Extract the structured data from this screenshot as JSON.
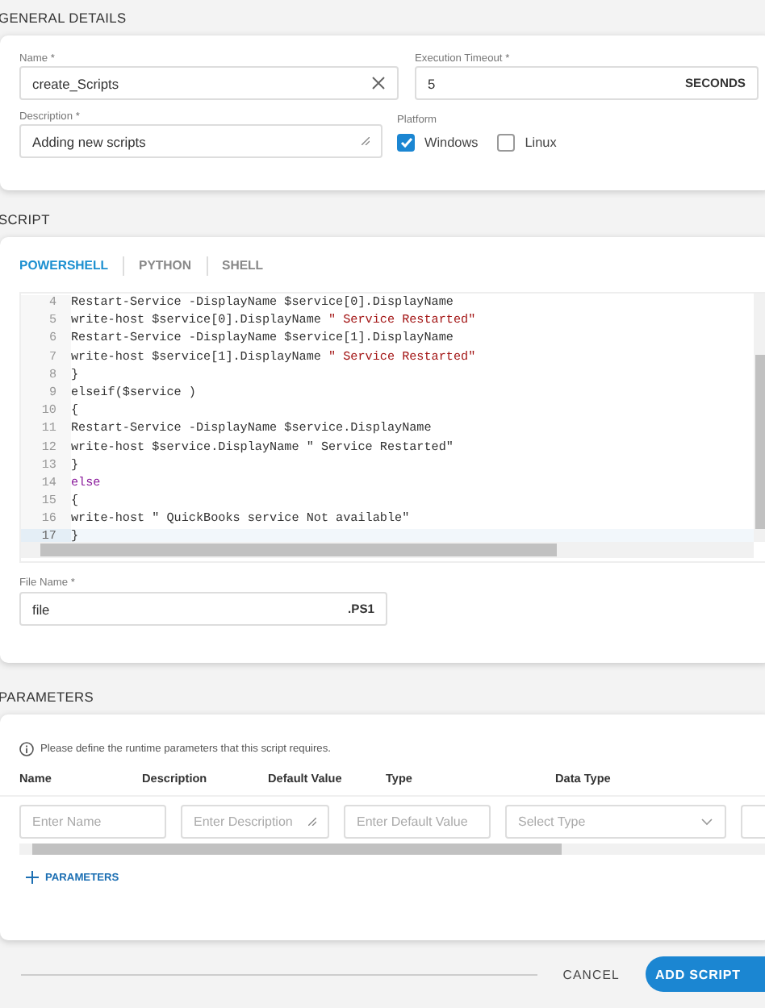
{
  "general": {
    "heading": "GENERAL DETAILS",
    "name": {
      "label": "Name *",
      "value": "create_Scripts"
    },
    "timeout": {
      "label": "Execution Timeout *",
      "value": "5",
      "unit": "SECONDS"
    },
    "description": {
      "label": "Description *",
      "value": "Adding new scripts"
    },
    "platform": {
      "label": "Platform",
      "options": [
        {
          "label": "Windows",
          "checked": true
        },
        {
          "label": "Linux",
          "checked": false
        }
      ]
    }
  },
  "script": {
    "heading": "SCRIPT",
    "tabs": [
      {
        "label": "POWERSHELL",
        "selected": true
      },
      {
        "label": "PYTHON",
        "selected": false
      },
      {
        "label": "SHELL",
        "selected": false
      }
    ],
    "editor": {
      "lines": [
        {
          "number": "4",
          "active": false,
          "tokens": [
            {
              "kind": "plain",
              "text": "Restart-Service -DisplayName $service[0].DisplayName"
            }
          ]
        },
        {
          "number": "5",
          "active": false,
          "tokens": [
            {
              "kind": "plain",
              "text": "write-host $service[0].DisplayName "
            },
            {
              "kind": "string",
              "text": "\" Service Restarted\""
            }
          ]
        },
        {
          "number": "6",
          "active": false,
          "tokens": [
            {
              "kind": "plain",
              "text": "Restart-Service -DisplayName $service[1].DisplayName"
            }
          ]
        },
        {
          "number": "7",
          "active": false,
          "tokens": [
            {
              "kind": "plain",
              "text": "write-host $service[1].DisplayName "
            },
            {
              "kind": "string",
              "text": "\" Service Restarted\""
            }
          ]
        },
        {
          "number": "8",
          "active": false,
          "tokens": [
            {
              "kind": "plain",
              "text": "}"
            }
          ]
        },
        {
          "number": "9",
          "active": false,
          "tokens": [
            {
              "kind": "plain",
              "text": "elseif($service )"
            }
          ]
        },
        {
          "number": "10",
          "active": false,
          "tokens": [
            {
              "kind": "plain",
              "text": "{"
            }
          ]
        },
        {
          "number": "11",
          "active": false,
          "tokens": [
            {
              "kind": "plain",
              "text": "Restart-Service -DisplayName $service.DisplayName"
            }
          ]
        },
        {
          "number": "12",
          "active": false,
          "tokens": [
            {
              "kind": "plain",
              "text": "write-host $service.DisplayName \" Service Restarted\""
            }
          ]
        },
        {
          "number": "13",
          "active": false,
          "tokens": [
            {
              "kind": "plain",
              "text": "}"
            }
          ]
        },
        {
          "number": "14",
          "active": false,
          "tokens": [
            {
              "kind": "keyword",
              "text": "else"
            }
          ]
        },
        {
          "number": "15",
          "active": false,
          "tokens": [
            {
              "kind": "plain",
              "text": "{"
            }
          ]
        },
        {
          "number": "16",
          "active": false,
          "tokens": [
            {
              "kind": "plain",
              "text": "write-host \" QuickBooks service Not available\""
            }
          ]
        },
        {
          "number": "17",
          "active": true,
          "tokens": [
            {
              "kind": "plain",
              "text": "}"
            }
          ]
        }
      ]
    },
    "file_name": {
      "label": "File Name *",
      "value": "file",
      "extension": ".PS1"
    }
  },
  "parameters": {
    "heading": "PARAMETERS",
    "info": "Please define the runtime parameters that this script requires.",
    "columns": [
      "Name",
      "Description",
      "Default Value",
      "Type",
      "Data Type"
    ],
    "fields": [
      {
        "kind": "input",
        "placeholder": "Enter Name"
      },
      {
        "kind": "textarea",
        "placeholder": "Enter Description"
      },
      {
        "kind": "input",
        "placeholder": "Enter Default Value"
      },
      {
        "kind": "select",
        "placeholder": "Select Type"
      },
      {
        "kind": "stub"
      }
    ],
    "add_label": "PARAMETERS"
  },
  "footer": {
    "cancel": "CANCEL",
    "submit": "ADD SCRIPT"
  }
}
